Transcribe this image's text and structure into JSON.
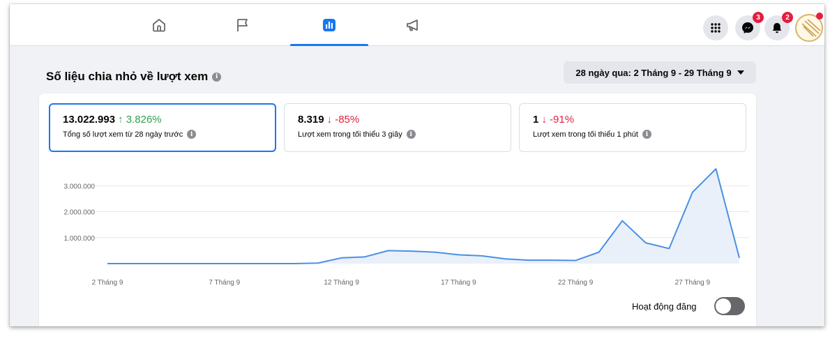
{
  "nav": {
    "tabs": [
      {
        "name": "home",
        "active": false
      },
      {
        "name": "pages",
        "active": false
      },
      {
        "name": "insights",
        "active": true
      },
      {
        "name": "ads",
        "active": false
      }
    ],
    "messenger_badge": "3",
    "notifications_badge": "2"
  },
  "section": {
    "title": "Số liệu chia nhỏ về lượt xem",
    "date_range": "28 ngày qua: 2 Tháng 9 - 29 Tháng 9"
  },
  "metrics": [
    {
      "value": "13.022.993",
      "delta": "↑ 3.826%",
      "direction": "up",
      "label": "Tổng số lượt xem từ 28 ngày trước"
    },
    {
      "value": "8.319",
      "delta": "↓ -85%",
      "direction": "down",
      "label": "Lượt xem trong tối thiểu 3 giây"
    },
    {
      "value": "1",
      "delta": "↓ -91%",
      "direction": "down",
      "label": "Lượt xem trong tối thiểu 1 phút"
    }
  ],
  "toggle": {
    "label": "Hoạt động đăng",
    "on": false
  },
  "colors": {
    "accent": "#1877f2",
    "up": "#31a24c",
    "down": "#e41e3f",
    "line": "#4a90e2",
    "area": "#eaf0fa"
  },
  "chart_data": {
    "type": "area",
    "y_ticks": [
      "1.000.000",
      "2.000.000",
      "3.000.000"
    ],
    "ylim": [
      0,
      3600000
    ],
    "x_tick_labels": [
      "2 Tháng 9",
      "7 Tháng 9",
      "12 Tháng 9",
      "17 Tháng 9",
      "22 Tháng 9",
      "27 Tháng 9"
    ],
    "x_tick_days": [
      2,
      7,
      12,
      17,
      22,
      27
    ],
    "x_range": [
      2,
      29
    ],
    "x": [
      2,
      3,
      4,
      5,
      6,
      7,
      8,
      9,
      10,
      11,
      12,
      13,
      14,
      15,
      16,
      17,
      18,
      19,
      20,
      21,
      22,
      23,
      24,
      25,
      26,
      27,
      28,
      29
    ],
    "values": [
      0,
      0,
      0,
      0,
      0,
      0,
      0,
      0,
      0,
      20000,
      220000,
      260000,
      500000,
      480000,
      440000,
      340000,
      300000,
      180000,
      130000,
      130000,
      120000,
      440000,
      1650000,
      800000,
      580000,
      2750000,
      3650000,
      220000
    ],
    "grid": true
  }
}
